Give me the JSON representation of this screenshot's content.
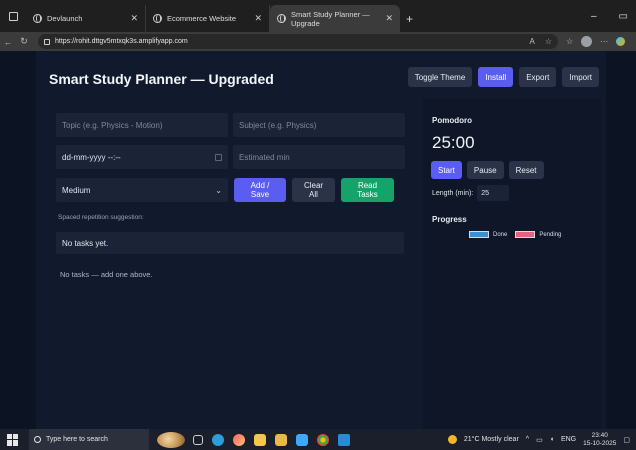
{
  "browser": {
    "tabs": [
      {
        "title": "Devlaunch"
      },
      {
        "title": "Ecommerce Website"
      },
      {
        "title": "Smart Study Planner — Upgrade"
      }
    ],
    "url": "https://rohit.dttgv5mtxqk3s.amplifyapp.com"
  },
  "header": {
    "title": "Smart Study Planner — Upgraded",
    "buttons": {
      "toggle_theme": "Toggle Theme",
      "install": "Install",
      "export": "Export",
      "import": "Import"
    }
  },
  "form": {
    "topic_placeholder": "Topic (e.g. Physics - Motion)",
    "subject_placeholder": "Subject (e.g. Physics)",
    "date_value": "dd-mm-yyyy --:--",
    "minutes_placeholder": "Estimated min",
    "priority_value": "Medium",
    "add_save": "Add / Save",
    "clear_all": "Clear All",
    "read_tasks": "Read Tasks"
  },
  "spaced": {
    "label": "Spaced repetition suggestion:",
    "value": "No tasks yet."
  },
  "tasks": {
    "empty_message": "No tasks — add one above."
  },
  "pomodoro": {
    "title": "Pomodoro",
    "time": "25:00",
    "start": "Start",
    "pause": "Pause",
    "reset": "Reset",
    "length_label": "Length (min):",
    "length_value": "25"
  },
  "progress": {
    "title": "Progress",
    "legend": [
      {
        "label": "Done",
        "color": "#3b8fd6"
      },
      {
        "label": "Pending",
        "color": "#e8617e"
      }
    ]
  },
  "taskbar": {
    "search_placeholder": "Type here to search",
    "weather": "21°C  Mostly clear",
    "language": "ENG",
    "time": "23:40",
    "date": "15-10-2025"
  },
  "colors": {
    "accent": "#5b5cf0",
    "success": "#16a36a",
    "background": "#111a2c"
  }
}
